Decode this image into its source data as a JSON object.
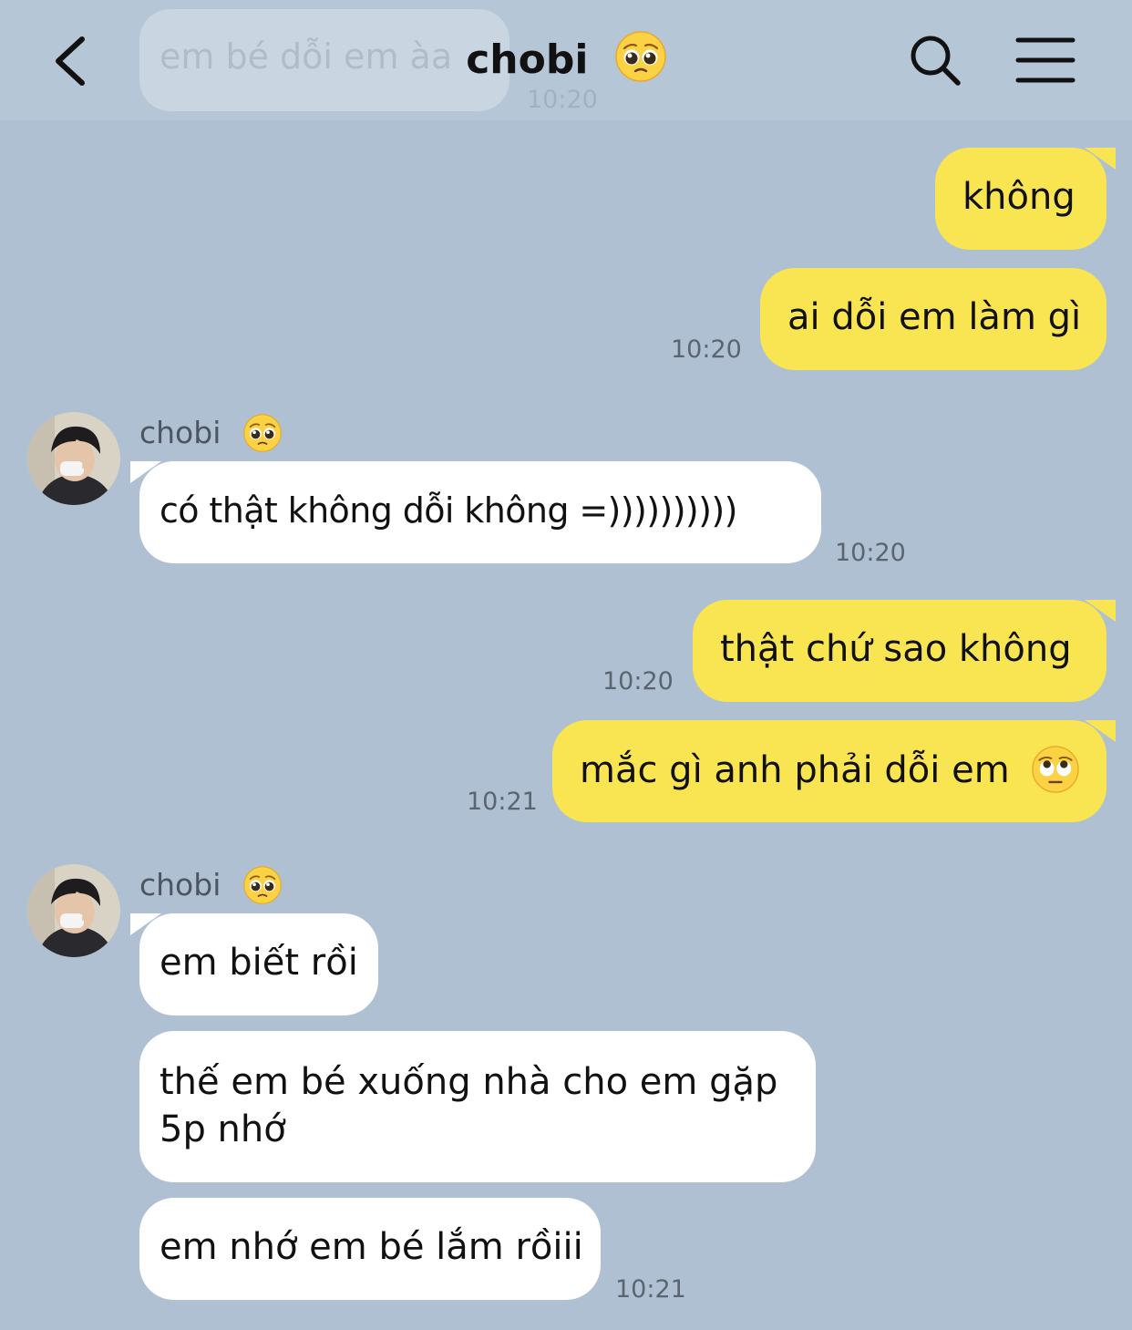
{
  "colors": {
    "background": "#aec0d2",
    "outgoing_bubble": "#f9e552",
    "incoming_bubble": "#ffffff",
    "timestamp_text": "#5b6570"
  },
  "header": {
    "title": "chobi",
    "title_emoji": "pleading-face",
    "back_icon": "chevron-left-icon",
    "search_icon": "search-icon",
    "menu_icon": "hamburger-menu-icon",
    "ghost_message": {
      "text": "em bé dỗi em àa",
      "time": "10:20"
    }
  },
  "messages": [
    {
      "from": "me",
      "text": "không"
    },
    {
      "from": "me",
      "text": "ai dỗi em làm gì",
      "time": "10:20"
    },
    {
      "from": "them",
      "sender": "chobi",
      "sender_emoji": "pleading-face",
      "text": "có thật không dỗi không =))))))))))",
      "time": "10:20"
    },
    {
      "from": "me",
      "text": "thật chứ sao không",
      "time": "10:20"
    },
    {
      "from": "me",
      "text": "mắc gì anh phải dỗi em",
      "emoji": "face-with-rolling-eyes",
      "time": "10:21"
    },
    {
      "from": "them",
      "sender": "chobi",
      "sender_emoji": "pleading-face",
      "text": "em biết rồi"
    },
    {
      "from": "them",
      "text": "thế em bé xuống nhà cho em gặp 5p nhớ"
    },
    {
      "from": "them",
      "text": "em nhớ em bé lắm rồiii",
      "time": "10:21"
    }
  ]
}
